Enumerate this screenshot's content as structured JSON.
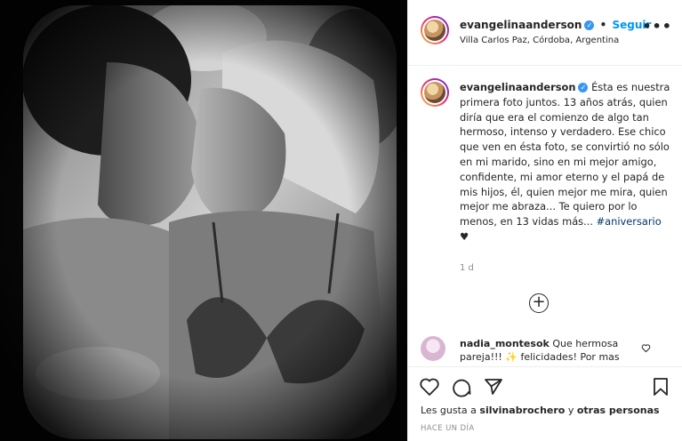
{
  "post": {
    "username": "evangelinaanderson",
    "follow_label": "Seguir",
    "separator": "•",
    "location": "Villa Carlos Paz, Córdoba, Argentina",
    "more_label": "•••",
    "caption_text": "Ésta es nuestra primera foto juntos. 13 años atrás, quien diría que era el comienzo de algo tan hermoso, intenso y verdadero. Ese chico que ven en ésta foto, se convirtió no sólo en mi marido, sino en mi mejor amigo, confidente, mi amor eterno y el papá de mis hijos, él, quien mejor me mira, quien mejor me abraza... Te quiero por lo menos, en 13 vidas más...",
    "hashtag": "#aniversario",
    "caption_heart": "♥",
    "time_ago": "1 d",
    "load_more": "+"
  },
  "comment": {
    "username": "nadia_montesok",
    "text": "Que hermosa pareja!!! ✨ felicidades! Por mas"
  },
  "likes": {
    "prefix": "Les gusta a",
    "user": "silvinabrochero",
    "conjunction": "y",
    "others": "otras personas"
  },
  "timestamp": "HACE UN DÍA",
  "icons": {
    "verified": "verified-badge-icon",
    "like": "heart-icon",
    "comment": "comment-icon",
    "share": "paper-plane-icon",
    "save": "bookmark-icon"
  },
  "colors": {
    "accent": "#0095f6",
    "verified": "#3897f0",
    "hashtag": "#00376b",
    "muted": "#8e8e8e"
  }
}
